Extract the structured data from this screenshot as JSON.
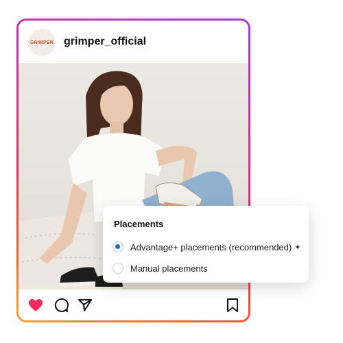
{
  "post": {
    "username": "grimper_official",
    "avatar_text": "GRIMPER"
  },
  "footer": {
    "icons": [
      "heart-icon",
      "comment-icon",
      "share-icon",
      "bookmark-icon"
    ],
    "like_color": "#ee2a5f"
  },
  "placements": {
    "title": "Placements",
    "options": [
      {
        "label": "Advantage+ placements (recommended)",
        "selected": true,
        "icon": "sparkle-icon"
      },
      {
        "label": "Manual placements",
        "selected": false
      }
    ]
  },
  "colors": {
    "gradient": [
      "#a53bd9",
      "#d62f8f",
      "#ee2a5f",
      "#f36b2c",
      "#f9a23a"
    ],
    "radio_selected": "#1a66d6"
  }
}
